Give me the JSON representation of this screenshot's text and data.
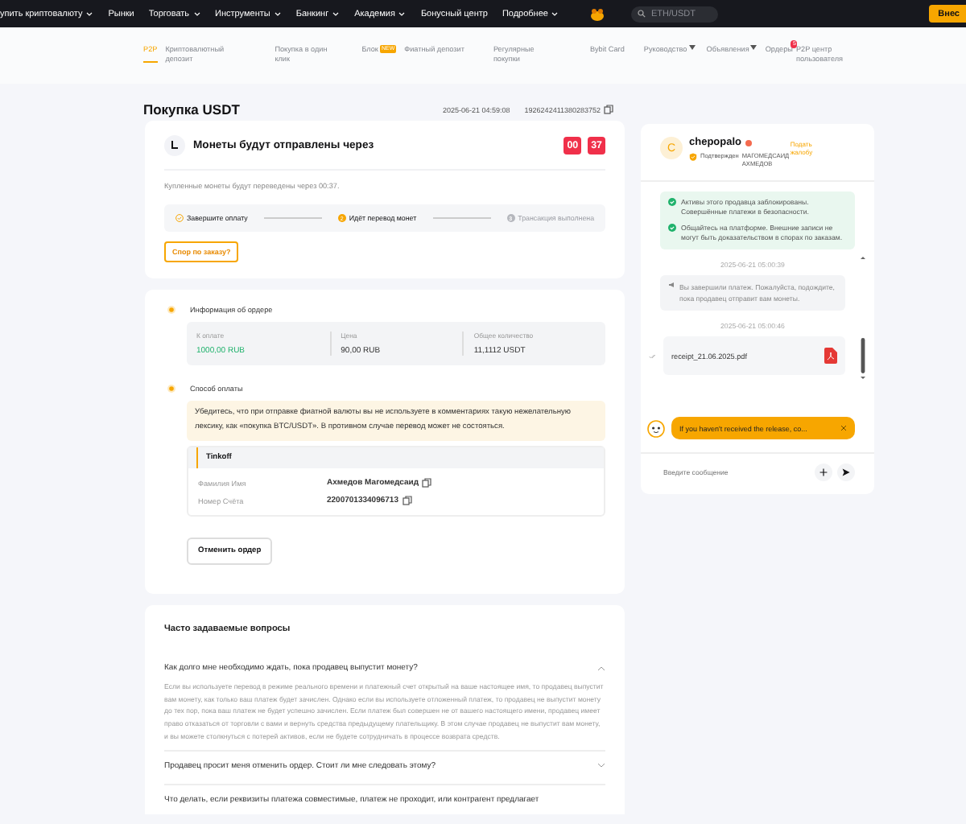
{
  "top_nav": {
    "items": [
      {
        "label": "упить криптовалюту",
        "dropdown": true
      },
      {
        "label": "Рынки",
        "dropdown": false
      },
      {
        "label": "Торговать",
        "dropdown": true
      },
      {
        "label": "Инструменты",
        "dropdown": true
      },
      {
        "label": "Банкинг",
        "dropdown": true
      },
      {
        "label": "Академия",
        "dropdown": true
      },
      {
        "label": "Бонусный центр",
        "dropdown": false
      },
      {
        "label": "Подробнее",
        "dropdown": true
      }
    ],
    "search": {
      "placeholder": "ETH/USDT"
    },
    "deposit_button": "Внес"
  },
  "sub_nav": {
    "items": [
      {
        "label": "P2P",
        "selected": true
      },
      {
        "label": "Криптовалютный депозит",
        "selected": false
      },
      {
        "label": "Покупка в один клик",
        "selected": false
      },
      {
        "label": "Блок",
        "selected": false,
        "tag": "NEW"
      },
      {
        "label": "Фиатный депозит",
        "selected": false
      },
      {
        "label": "Регулярные покупки",
        "selected": false
      },
      {
        "label": "Bybit Card",
        "selected": false
      },
      {
        "label": "Руководство",
        "selected": false,
        "dropdown": true
      },
      {
        "label": "Объявления",
        "selected": false,
        "dropdown": true
      },
      {
        "label": "Ордеры",
        "selected": false,
        "count": "5"
      },
      {
        "label": "P2P центр пользователя",
        "selected": false
      }
    ]
  },
  "page": {
    "title": "Покупка USDT",
    "timestamp": "2025-06-21 04:59:08",
    "order_id": "1926242411380283752"
  },
  "countdown": {
    "title": "Монеты будут отправлены через",
    "minutes": "00",
    "seconds": "37",
    "note": "Купленные монеты будут переведены через 00:37.",
    "steps": [
      {
        "label": "Завершите оплату",
        "completed": true,
        "active": false
      },
      {
        "label": "Идёт перевод монет",
        "number": "2",
        "completed": false,
        "active": true
      },
      {
        "label": "Трансакция выполнена",
        "number": "3",
        "completed": false,
        "active": false
      }
    ],
    "dispute_button": "Спор по заказу?"
  },
  "order_info": {
    "heading": "Информация об ордере",
    "fields": [
      {
        "label": "К оплате",
        "value": "1000,00 RUB",
        "highlight": true
      },
      {
        "label": "Цена",
        "value": "90,00 RUB",
        "highlight": false
      },
      {
        "label": "Общее количество",
        "value": "11,1112 USDT",
        "highlight": false
      }
    ]
  },
  "payment": {
    "heading": "Способ оплаты",
    "warning": "Убедитесь, что при отправке фиатной валюты вы не используете в комментариях такую нежелательную лексику, как «покупка BTC/USDT». В противном случае перевод может не состояться.",
    "bank": "Tinkoff",
    "details": [
      {
        "label": "Фамилия Имя",
        "value": "Ахмедов Магомедсаид"
      },
      {
        "label": "Номер Счёта",
        "value": "2200701334096713"
      }
    ],
    "cancel_button": "Отменить ордер"
  },
  "faq": {
    "title": "Часто задаваемые вопросы",
    "items": [
      {
        "question": "Как долго мне необходимо ждать, пока продавец выпустит монету?",
        "expanded": true,
        "answer": "Если вы используете перевод в режиме реального времени и платежный счет открытый на ваше настоящее имя, то продавец выпустит вам монету, как только ваш платеж будет зачислен. Однако если вы используете отложенный платеж, то продавец не выпустит монету до тех пор, пока ваш платеж не будет успешно зачислен. Если платеж был совершен не от вашего настоящего имени, продавец имеет право отказаться от торговли с вами и вернуть средства предыдущему плательщику. В этом случае продавец не выпустит вам монету, и вы можете столкнуться с потерей активов, если не будете сотрудничать в процессе возврата средств."
      },
      {
        "question": "Продавец просит меня отменить ордер. Стоит ли мне следовать этому?",
        "expanded": false
      },
      {
        "question": "Что делать, если реквизиты платежа совместимые, платеж не проходит, или контрагент предлагает",
        "expanded": false
      }
    ]
  },
  "chat": {
    "avatar_letter": "C",
    "name": "chepopalo",
    "verified_label": "Подтвержден",
    "real_name": "МАГОМЕДСАИД АХМЕДОВ",
    "complaint_link": "Подать жалобу",
    "notices": [
      "Активы этого продавца заблокированы. Совершённые платежи в безопасности.",
      "Общайтесь на платформе. Внешние записи не могут быть доказательством в спорах по заказам."
    ],
    "messages": [
      {
        "kind": "time",
        "text": "2025-06-21 05:00:39"
      },
      {
        "kind": "system",
        "text": "Вы завершили платеж. Пожалуйста, подождите, пока продавец отправит вам монеты."
      },
      {
        "kind": "time",
        "text": "2025-06-21 05:00:46"
      },
      {
        "kind": "file",
        "text": "receipt_21.06.2025.pdf"
      }
    ],
    "banner": "If you haven't received the release, co...",
    "input": {
      "placeholder": "Введите сообщение"
    }
  }
}
